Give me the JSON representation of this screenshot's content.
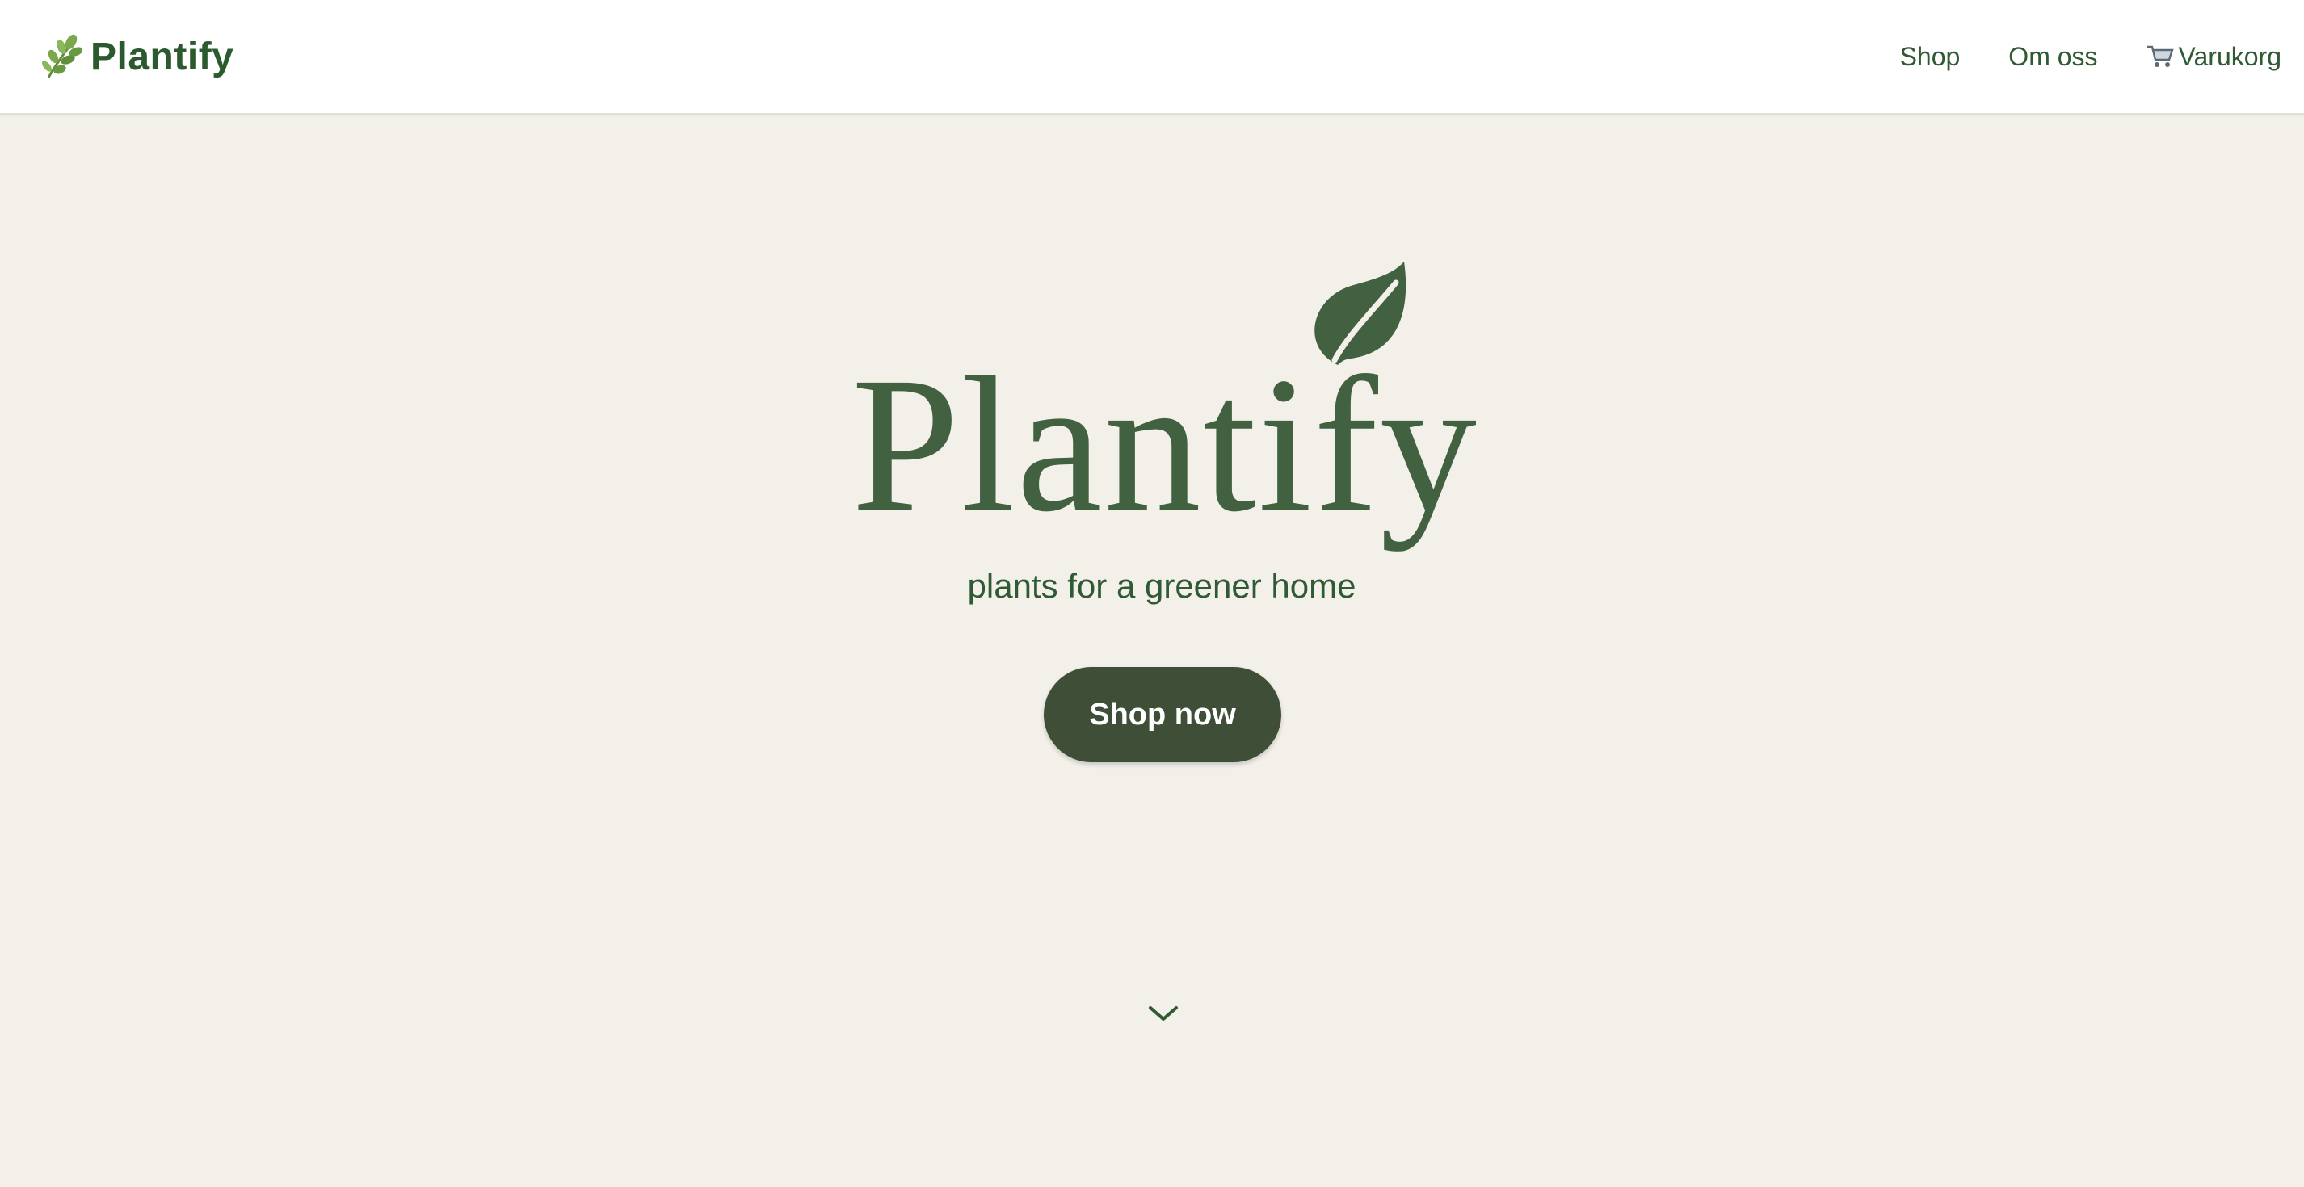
{
  "nav": {
    "brand": "Plantify",
    "brand_icon": "herb-sprig-icon",
    "links": [
      {
        "label": "Shop"
      },
      {
        "label": "Om oss"
      },
      {
        "label": "Varukorg",
        "icon": "shopping-cart-icon"
      }
    ]
  },
  "hero": {
    "wordmark": "Plantify",
    "leaf_icon": "leaf-icon",
    "tagline": "plants for a greener home",
    "cta_label": "Shop now",
    "scroll_icon": "chevron-down-icon"
  },
  "colors": {
    "background": "#f3f0ea",
    "header": "#ffffff",
    "brand_green": "#2c5a2f",
    "logo_green": "#426140",
    "button": "#3f4e37",
    "button_text": "#ffffff"
  }
}
